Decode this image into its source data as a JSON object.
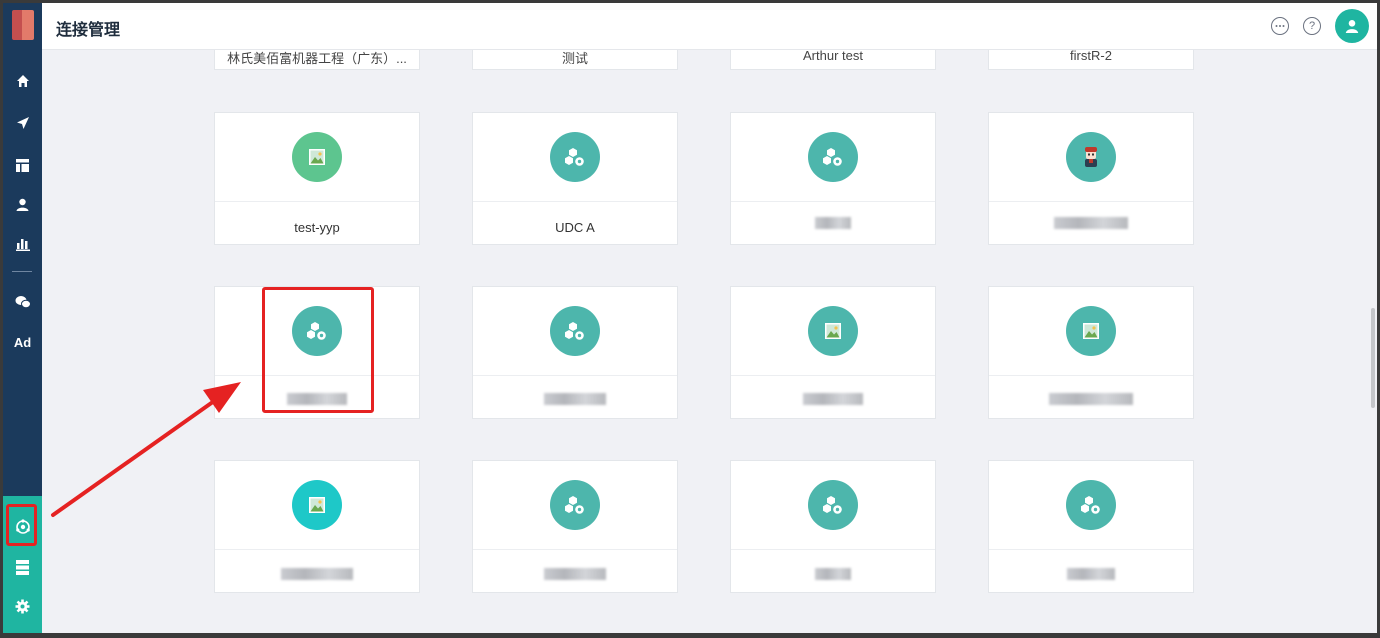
{
  "header": {
    "title": "连接管理"
  },
  "sidebar": {
    "items": [
      {
        "name": "home-icon"
      },
      {
        "name": "send-icon"
      },
      {
        "name": "layout-icon"
      },
      {
        "name": "user-icon"
      },
      {
        "name": "bar-chart-icon"
      },
      {
        "name": "wechat-icon"
      },
      {
        "ad_label": "Ad"
      }
    ],
    "bottom_items": [
      {
        "name": "connection-icon",
        "active": true
      },
      {
        "name": "server-icon"
      },
      {
        "name": "gear-icon"
      }
    ]
  },
  "colors": {
    "sidebar": "#1b3a5c",
    "accent": "#1fb5a1",
    "card_icon_teal": "#4db6ac",
    "card_icon_green": "#5dc58f",
    "card_icon_cyan": "#1ec8c8",
    "highlight": "#e52222"
  },
  "cards": {
    "row0": [
      {
        "label": "林氏美佰富机器工程（广东）..."
      },
      {
        "label": "测试"
      },
      {
        "label": "Arthur test"
      },
      {
        "label": "firstR-2"
      }
    ],
    "row1": [
      {
        "label": "test-yyp",
        "icon": "image-icon"
      },
      {
        "label": "UDC A",
        "icon": "cubes-gear-icon"
      },
      {
        "label": "",
        "icon": "cubes-gear-icon"
      },
      {
        "label": "",
        "icon": "character-avatar-icon"
      }
    ],
    "row2": [
      {
        "label": "",
        "icon": "cubes-gear-icon"
      },
      {
        "label": "",
        "icon": "cubes-gear-icon"
      },
      {
        "label": "",
        "icon": "image-icon"
      },
      {
        "label": "",
        "icon": "image-icon"
      }
    ],
    "row3": [
      {
        "label": "",
        "icon": "image-icon"
      },
      {
        "label": "",
        "icon": "cubes-gear-icon"
      },
      {
        "label": "",
        "icon": "cubes-gear-icon"
      },
      {
        "label": "",
        "icon": "cubes-gear-icon"
      }
    ]
  }
}
